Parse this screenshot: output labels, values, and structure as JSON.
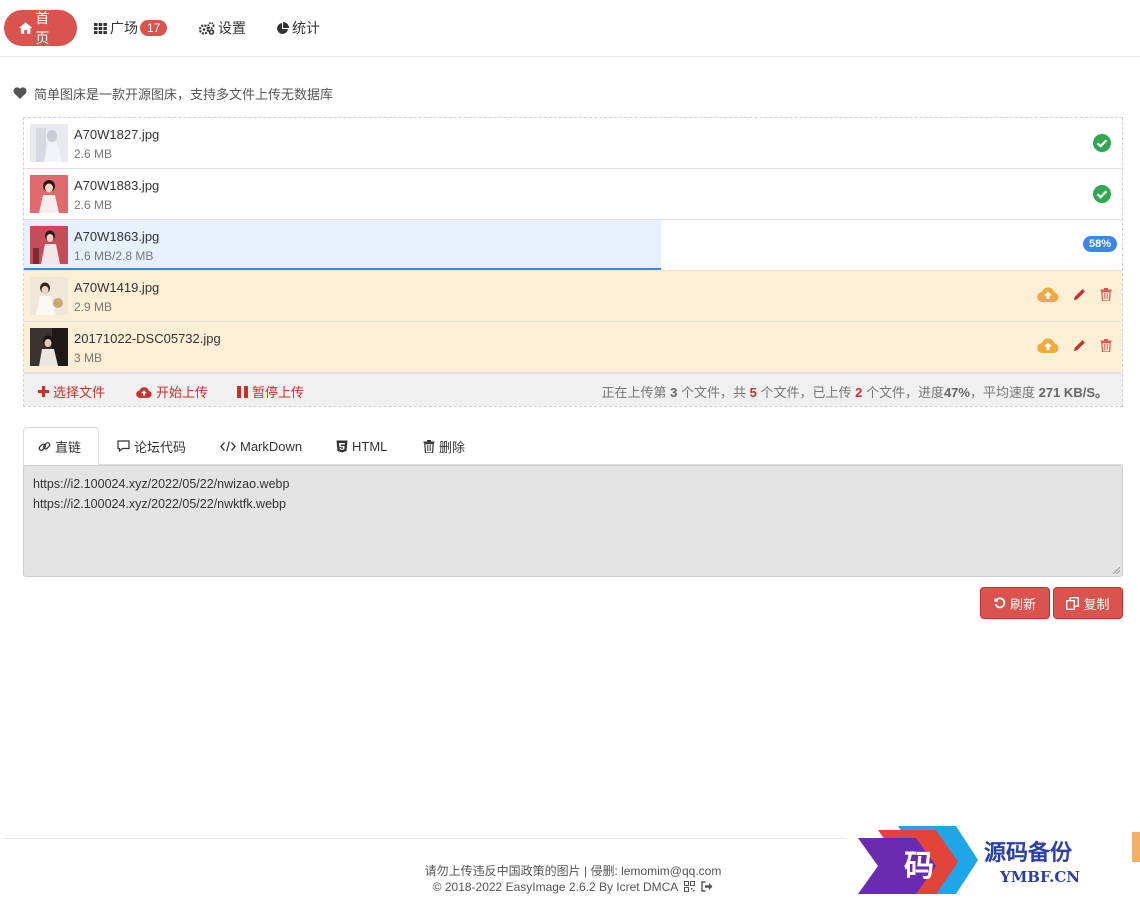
{
  "nav": {
    "home": "首页",
    "square": "广场",
    "square_count": "17",
    "settings": "设置",
    "stats": "统计"
  },
  "intro": "简单图床是一款开源图床，支持多文件上传无数据库",
  "files": [
    {
      "name": "A70W1827.jpg",
      "size": "2.6 MB",
      "status": "done"
    },
    {
      "name": "A70W1883.jpg",
      "size": "2.6 MB",
      "status": "done"
    },
    {
      "name": "A70W1863.jpg",
      "size": "1.6 MB/2.8 MB",
      "status": "uploading",
      "progress_label": "58%"
    },
    {
      "name": "A70W1419.jpg",
      "size": "2.9 MB",
      "status": "pending"
    },
    {
      "name": "20171022-DSC05732.jpg",
      "size": "3 MB",
      "status": "pending"
    }
  ],
  "upload_progress": {
    "current_file_fraction": 0.58
  },
  "upload_footer": {
    "choose": "选择文件",
    "start": "开始上传",
    "pause": "暂停上传",
    "status_prefix": "正在上传第",
    "current": "3",
    "status_mid1": "个文件，共",
    "total": "5",
    "status_mid2": "个文件，已上传",
    "uploaded": "2",
    "status_mid3": "个文件，进度",
    "progress": "47%",
    "status_mid4": "，平均速度",
    "speed": "271 KB/S。"
  },
  "tabs": [
    "直链",
    "论坛代码",
    "MarkDown",
    "HTML",
    "删除"
  ],
  "links": [
    "https://i2.100024.xyz/2022/05/22/nwizao.webp",
    "https://i2.100024.xyz/2022/05/22/nwktfk.webp"
  ],
  "buttons": {
    "refresh": "刷新",
    "copy": "复制"
  },
  "footer": {
    "line1": "请勿上传违反中国政策的图片 | 侵删: lemomim@qq.com",
    "line2": "© 2018-2022 EasyImage 2.6.2 By Icret DMCA"
  },
  "watermark": {
    "cn": "源码备份",
    "en": "YMBF.CN",
    "glyph": "码"
  },
  "colors": {
    "accent": "#d9534f",
    "progress": "#3b86e6",
    "success": "#2fa84f",
    "warning": "#f0a93b",
    "pending_bg": "#fdefd6"
  }
}
